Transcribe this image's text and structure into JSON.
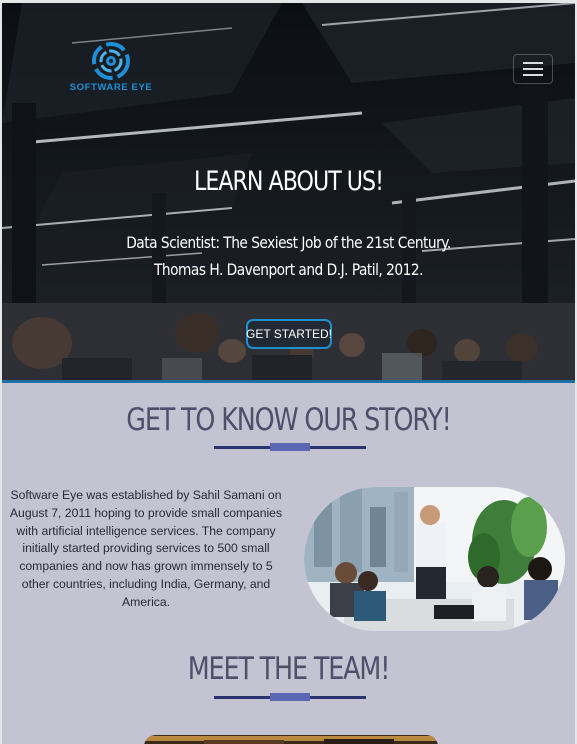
{
  "header": {
    "brand_name": "SOFTWARE EYE",
    "logo_icon": "software-eye-logo-icon",
    "menu_icon": "hamburger-menu-icon"
  },
  "hero": {
    "title": "LEARN ABOUT US!",
    "quote_line1": "Data Scientist: The Sexiest Job of the 21st Century.",
    "quote_line2": "Thomas H. Davenport and D.J. Patil, 2012.",
    "cta_label": "GET STARTED!"
  },
  "story": {
    "heading": "GET TO KNOW OUR STORY!",
    "body": "Software Eye was established by Sahil Samani on August 7, 2011 hoping to provide small companies with artificial intelligence services. The company initially started providing services to 500 small companies and now has grown immensely to 5 other countries, including India, Germany, and America."
  },
  "team": {
    "heading": "MEET THE TEAM!"
  },
  "colors": {
    "accent": "#1e8fd0",
    "section_bg": "#c3c3d1",
    "heading": "#4e4f6b",
    "divider": "#2c3470",
    "divider_highlight": "#5b66b4"
  }
}
